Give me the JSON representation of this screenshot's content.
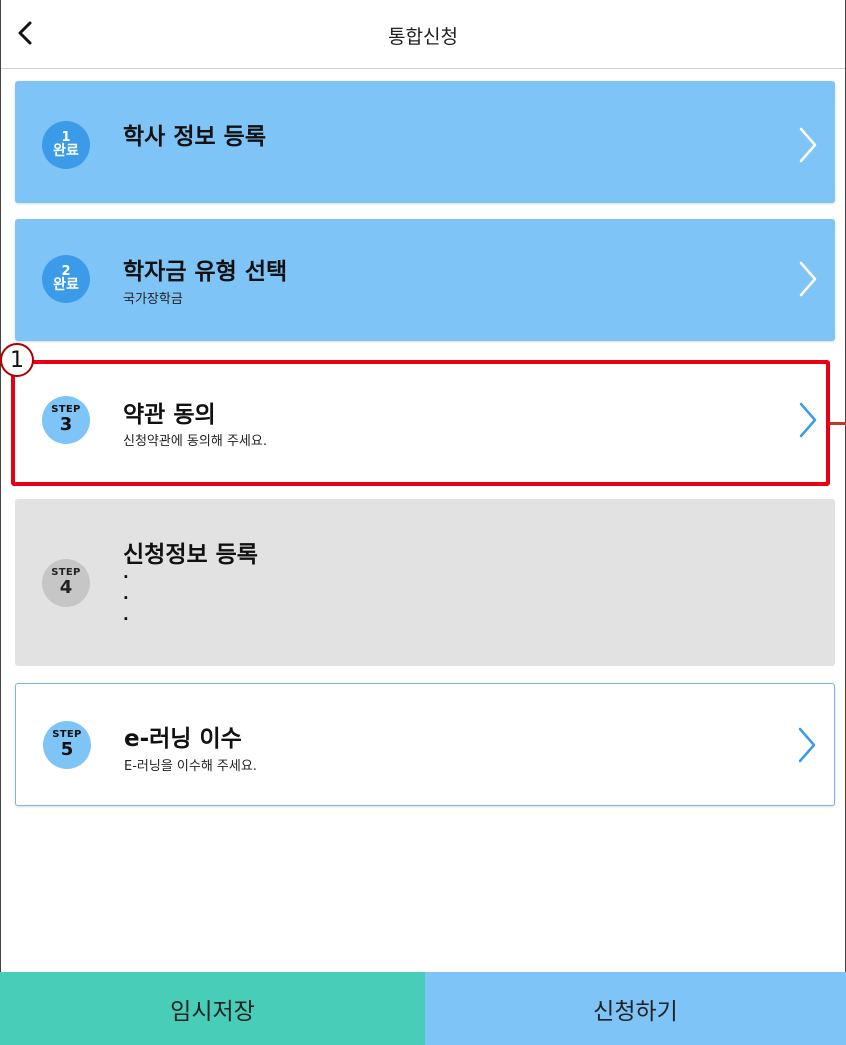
{
  "header": {
    "title": "통합신청",
    "back_icon": "chevron-left-icon"
  },
  "steps": [
    {
      "badge_top": "1",
      "badge_bottom": "완료",
      "title": "학사 정보 등록",
      "subtitle": "",
      "state": "completed"
    },
    {
      "badge_top": "2",
      "badge_bottom": "완료",
      "title": "학자금 유형 선택",
      "subtitle": "국가장학금",
      "state": "completed"
    },
    {
      "badge_top": "STEP",
      "badge_bottom": "3",
      "title": "약관 동의",
      "subtitle": "신청약관에 동의해 주세요.",
      "state": "current"
    },
    {
      "badge_top": "STEP",
      "badge_bottom": "4",
      "title": "신청정보 등록",
      "dots": [
        "·",
        "·",
        "·"
      ],
      "state": "disabled"
    },
    {
      "badge_top": "STEP",
      "badge_bottom": "5",
      "title": "e-러닝 이수",
      "subtitle": "E-러닝을 이수해 주세요.",
      "state": "pending"
    }
  ],
  "annotation": {
    "marker_label": "1",
    "highlight_color": "#e60012"
  },
  "footer": {
    "temp_save_label": "임시저장",
    "apply_label": "신청하기"
  },
  "colors": {
    "completed": "#7ec4f7",
    "completed_badge": "#3c9be8",
    "disabled": "#e2e2e2",
    "temp_save": "#47cdb8",
    "apply": "#7ec4f7"
  }
}
